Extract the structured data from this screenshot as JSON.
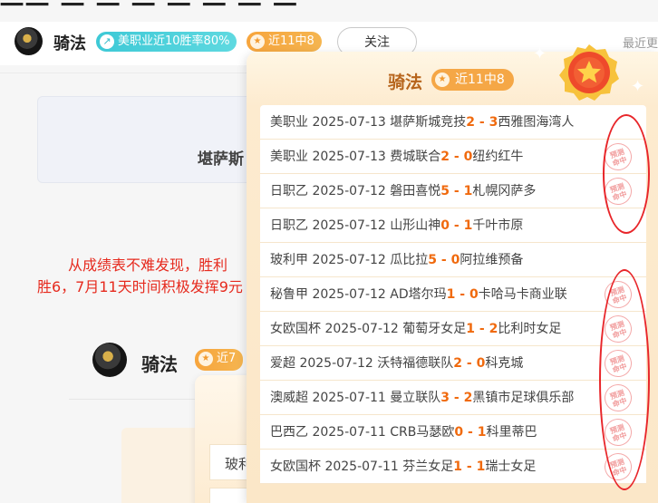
{
  "header": {
    "username": "骑法",
    "win_rate_badge": "美职业近10胜率80%",
    "streak_badge": "近11中8",
    "follow_label": "关注",
    "recent_label": "最近更"
  },
  "top_cut_text": "一一 一 一 一  一 一 一 一",
  "card1_text": "堪萨斯",
  "analysis": {
    "line1": "从成绩表不难发现，胜利",
    "line2": "胜6，7月11天时间积极发挥9元"
  },
  "second_post": {
    "username": "骑法",
    "badge_prefix": "近7",
    "row_partial": "玻利"
  },
  "popup": {
    "title": "骑法",
    "badge": "近11中8",
    "stamp_text_1": "预测",
    "stamp_text_2": "命中",
    "rows": [
      {
        "league": "美职业",
        "date": "2025-07-13",
        "home": "堪萨斯城竞技",
        "hs": "2",
        "sep": " - ",
        "as": "3",
        "away": "西雅图海湾人",
        "hit": false
      },
      {
        "league": "美职业",
        "date": "2025-07-13",
        "home": "费城联合",
        "hs": "2",
        "sep": " - ",
        "as": "0",
        "away": "纽约红牛",
        "hit": true
      },
      {
        "league": "日职乙",
        "date": "2025-07-12",
        "home": "磐田喜悦",
        "hs": "5",
        "sep": " - ",
        "as": "1",
        "away": "札幌冈萨多",
        "hit": true
      },
      {
        "league": "日职乙",
        "date": "2025-07-12",
        "home": "山形山神",
        "hs": "0",
        "sep": " - ",
        "as": "1",
        "away": "千叶市原",
        "hit": false
      },
      {
        "league": "玻利甲",
        "date": "2025-07-12",
        "home": "瓜比拉",
        "hs": "5",
        "sep": " - ",
        "as": "0",
        "away": "阿拉维预备",
        "hit": false
      },
      {
        "league": "秘鲁甲",
        "date": "2025-07-12",
        "home": "AD塔尔玛",
        "hs": "1",
        "sep": " - ",
        "as": "0",
        "away": "卡哈马卡商业联",
        "hit": true
      },
      {
        "league": "女欧国杯",
        "date": "2025-07-12",
        "home": "葡萄牙女足",
        "hs": "1",
        "sep": " - ",
        "as": "2",
        "away": "比利时女足",
        "hit": true
      },
      {
        "league": "爱超",
        "date": "2025-07-12",
        "home": "沃特福德联队",
        "hs": "2",
        "sep": " - ",
        "as": "0",
        "away": "科克城",
        "hit": true
      },
      {
        "league": "澳威超",
        "date": "2025-07-11",
        "home": "曼立联队",
        "hs": "3",
        "sep": " - ",
        "as": "2",
        "away": "黑镇市足球俱乐部",
        "hit": true
      },
      {
        "league": "巴西乙",
        "date": "2025-07-11",
        "home": "CRB马瑟欧",
        "hs": "0",
        "sep": " - ",
        "as": "1",
        "away": "科里蒂巴",
        "hit": true
      },
      {
        "league": "女欧国杯",
        "date": "2025-07-11",
        "home": "芬兰女足",
        "hs": "1",
        "sep": " - ",
        "as": "1",
        "away": "瑞士女足",
        "hit": true
      }
    ]
  },
  "colors": {
    "accent_orange": "#f5a746",
    "score_orange": "#f06a0e",
    "highlight_red": "#e8262a",
    "badge_teal": "#3ec9d6"
  }
}
